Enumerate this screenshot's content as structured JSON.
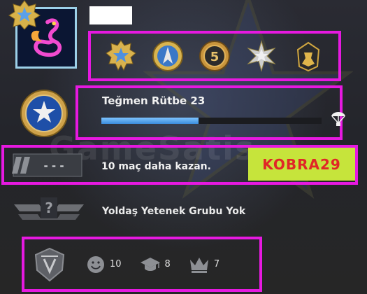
{
  "profile": {
    "name": "",
    "avatar": "pink-swan-avatar",
    "badge": "service-star-icon"
  },
  "medals": [
    {
      "name": "service-medal-star-icon"
    },
    {
      "name": "operation-coin-icon"
    },
    {
      "name": "five-year-coin-icon"
    },
    {
      "name": "silver-star-medal-icon"
    },
    {
      "name": "soldier-pin-icon"
    }
  ],
  "rank": {
    "title": "Teğmen Rütbe 23",
    "xp_progress": 0.44,
    "drop_icon": "parachute-drop-icon"
  },
  "win": {
    "badge_text": "- - -",
    "text": "10 maç daha kazan.",
    "promo": "KOBRA29"
  },
  "skill": {
    "text": "Yoldaş Yetenek Grubu Yok"
  },
  "stats": {
    "service_icon": "service-emblem-icon",
    "friendly": {
      "icon": "smiley-icon",
      "value": "10"
    },
    "teacher": {
      "icon": "grad-cap-icon",
      "value": "8"
    },
    "leader": {
      "icon": "crown-icon",
      "value": "7"
    }
  },
  "watermark": "GameSatis",
  "colors": {
    "highlight": "#e619e0",
    "promo_bg": "#c6e43b",
    "promo_text": "#e02727",
    "xp": "#4aa3ee"
  }
}
